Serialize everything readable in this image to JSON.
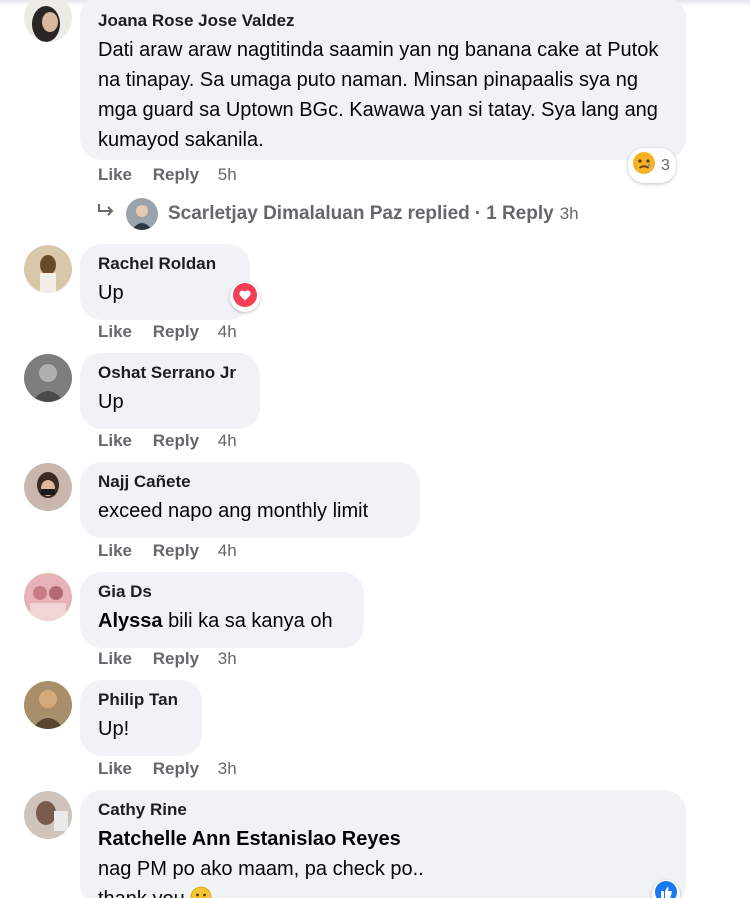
{
  "actions": {
    "like": "Like",
    "reply": "Reply"
  },
  "colors": {
    "bubble": "#f0f2f5",
    "meta": "#65676b",
    "heart": "#f33e58"
  },
  "comments": [
    {
      "author": "Joana Rose Jose Valdez",
      "text": "Dati araw araw nagtitinda saamin yan ng banana cake at Putok na tinapay. Sa umaga puto naman. Minsan pinapaalis sya ng mga guard sa Uptown BGc. Kawawa yan si tatay. Sya lang ang kumayod sakanila.",
      "time": "5h",
      "reaction": {
        "icon": "sad-face-icon",
        "count": "3"
      },
      "replies": {
        "name": "Scarletjay Dimalaluan Paz",
        "verb": "replied",
        "count_text": "1 Reply",
        "time": "3h"
      }
    },
    {
      "author": "Rachel Roldan",
      "text": "Up",
      "time": "4h",
      "reaction": {
        "icon": "heart-icon"
      }
    },
    {
      "author": "Oshat Serrano Jr",
      "text": "Up",
      "time": "4h"
    },
    {
      "author": "Najj Cañete",
      "text": "exceed napo ang monthly limit",
      "time": "4h"
    },
    {
      "author": "Gia Ds",
      "mention": "Alyssa",
      "text": "bili ka sa kanya oh",
      "time": "3h"
    },
    {
      "author": "Philip Tan",
      "text": "Up!",
      "time": "3h"
    },
    {
      "author": "Cathy Rine",
      "mention": "Ratchelle Ann Estanislao Reyes",
      "text": "nag PM po ako maam, pa check po.. thank you",
      "emoji": "smiley-icon"
    }
  ]
}
